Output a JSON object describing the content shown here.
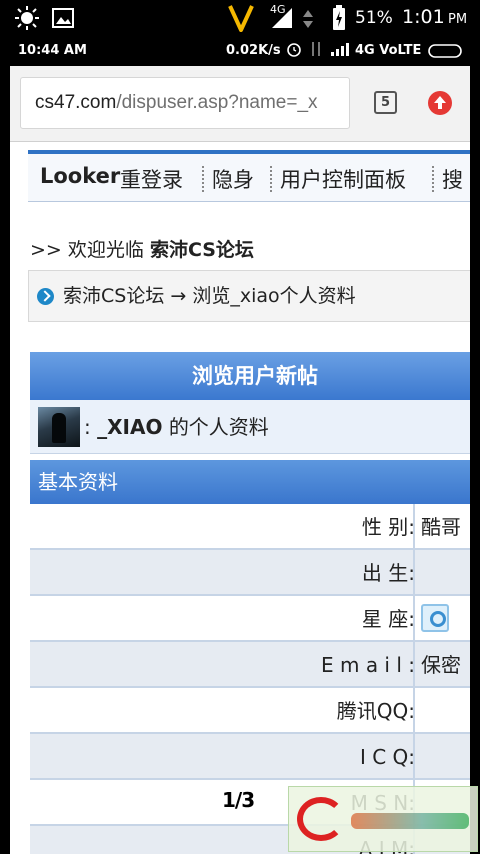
{
  "status_top": {
    "signal_label": "4G",
    "battery": "51%",
    "time": "1:01",
    "ampm": "PM"
  },
  "status_second": {
    "time": "10:44 AM",
    "speed": "0.02K/s",
    "network": "4G VoLTE"
  },
  "browser": {
    "url_host": "cs47.com",
    "url_path": "/dispuser.asp?name=_x",
    "tab_count": "5"
  },
  "navbar": {
    "items": [
      "Looker",
      "重登录",
      "隐身",
      "用户控制面板",
      "搜"
    ]
  },
  "welcome": {
    "prefix": ">> 欢迎光临",
    "forum": "索沛CS论坛"
  },
  "breadcrumb": {
    "text": "索沛CS论坛 → 浏览_xiao个人资料"
  },
  "profile": {
    "header": "浏览用户新帖",
    "name_prefix": ":",
    "username": "_XIAO",
    "name_suffix": "的个人资料",
    "section": "基本资料",
    "fields": [
      {
        "label": "性 别:",
        "value": "酷哥"
      },
      {
        "label": "出 生:",
        "value": ""
      },
      {
        "label": "星 座:",
        "value": ""
      },
      {
        "label": "E m a i l :",
        "value": "保密"
      },
      {
        "label": "腾讯QQ:",
        "value": ""
      },
      {
        "label": "I C Q:",
        "value": ""
      },
      {
        "label": "M S N:",
        "value": ""
      },
      {
        "label": "A I M:",
        "value": ""
      }
    ]
  },
  "pager": "1/3",
  "colors": {
    "accent_blue": "#3b78cf",
    "update_red": "#e53935",
    "status_yellow": "#f5b800"
  }
}
